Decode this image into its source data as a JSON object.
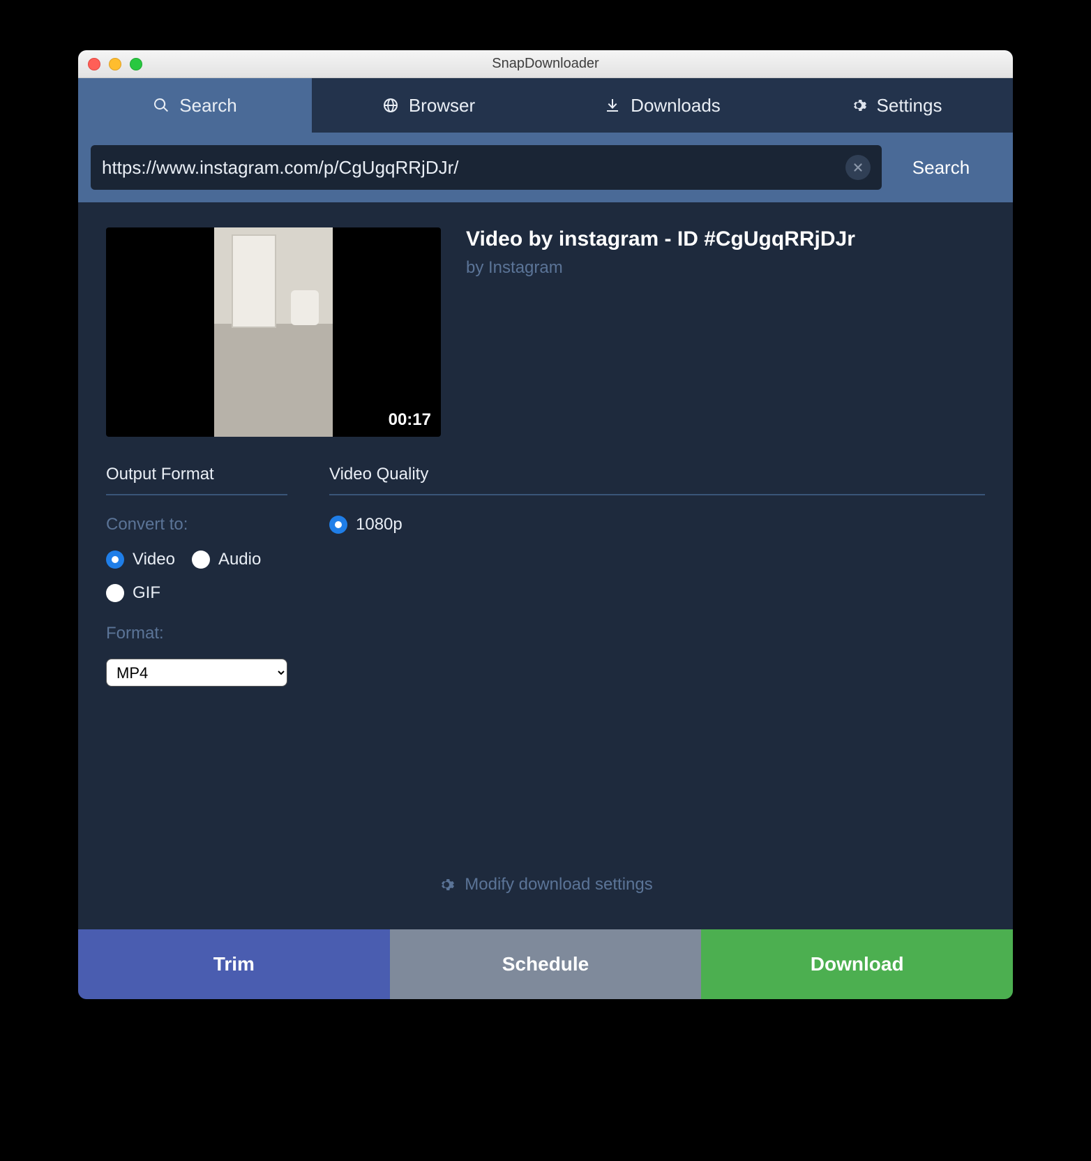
{
  "window": {
    "title": "SnapDownloader"
  },
  "tabs": [
    {
      "id": "search",
      "label": "Search",
      "icon": "search-icon",
      "active": true
    },
    {
      "id": "browser",
      "label": "Browser",
      "icon": "globe-icon",
      "active": false
    },
    {
      "id": "downloads",
      "label": "Downloads",
      "icon": "download-arrow-icon",
      "active": false
    },
    {
      "id": "settings",
      "label": "Settings",
      "icon": "gear-icon",
      "active": false
    }
  ],
  "searchbar": {
    "url": "https://www.instagram.com/p/CgUgqRRjDJr/",
    "search_button": "Search"
  },
  "video": {
    "title": "Video by instagram - ID #CgUgqRRjDJr",
    "source_label": "by Instagram",
    "duration": "00:17"
  },
  "output_format": {
    "header": "Output Format",
    "convert_label": "Convert to:",
    "options": [
      {
        "id": "video",
        "label": "Video",
        "selected": true
      },
      {
        "id": "audio",
        "label": "Audio",
        "selected": false
      },
      {
        "id": "gif",
        "label": "GIF",
        "selected": false
      }
    ],
    "format_label": "Format:",
    "format_value": "MP4"
  },
  "video_quality": {
    "header": "Video Quality",
    "options": [
      {
        "id": "1080p",
        "label": "1080p",
        "selected": true
      }
    ]
  },
  "modify_settings": {
    "label": "Modify download settings"
  },
  "actions": {
    "trim": "Trim",
    "schedule": "Schedule",
    "download": "Download"
  },
  "colors": {
    "tab_active": "#4a6a97",
    "tab_bg": "#23334c",
    "content_bg": "#1e2a3d",
    "accent_blue": "#1f7ee8",
    "trim": "#4a5db0",
    "schedule": "#7f8a9b",
    "download": "#4caf50"
  }
}
